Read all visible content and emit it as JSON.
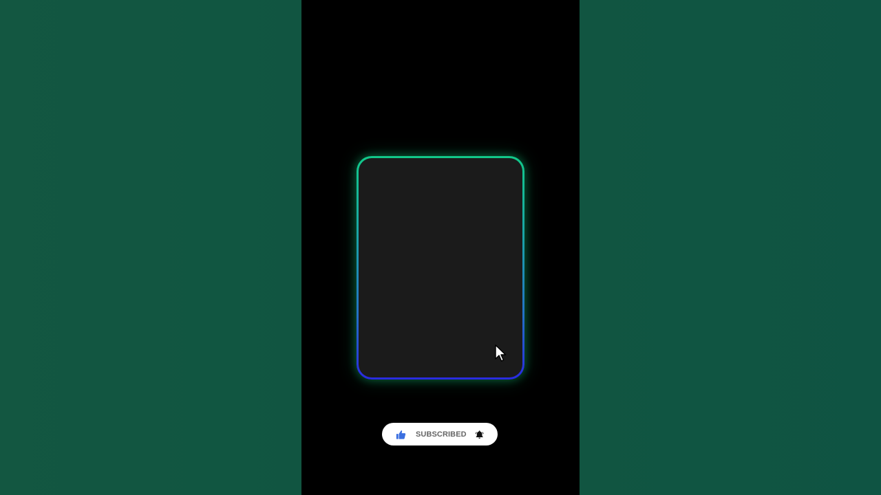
{
  "subscribe": {
    "label": "SUBSCRIBED",
    "like_icon": "thumbs-up-icon",
    "bell_icon": "bell-icon"
  },
  "colors": {
    "side_panels": "#115641",
    "center_background": "#000000",
    "card_fill": "#1b1b1b",
    "card_border_top": "#12c98a",
    "card_border_bottom": "#2a2ae0",
    "like_blue": "#3b6fe0",
    "pill_background": "#ffffff",
    "label_text": "#666666"
  }
}
